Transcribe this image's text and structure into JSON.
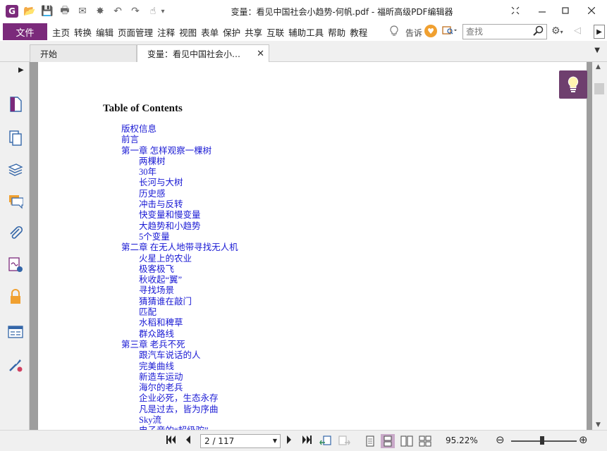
{
  "window": {
    "title": "变量：看见中国社会小趋势-何帆.pdf - 福昕高级PDF编辑器",
    "logo_letter": "G"
  },
  "quick_access": [
    {
      "name": "open-folder-icon",
      "glyph": "📂"
    },
    {
      "name": "save-icon",
      "glyph": "💾"
    },
    {
      "name": "print-icon",
      "glyph": "🖶"
    },
    {
      "name": "email-icon",
      "glyph": "✉"
    },
    {
      "name": "new-icon",
      "glyph": "✸"
    },
    {
      "name": "undo-icon",
      "glyph": "↶"
    },
    {
      "name": "redo-icon",
      "glyph": "↷"
    },
    {
      "name": "hand-tool-icon",
      "glyph": "☝"
    },
    {
      "name": "customize-dropdown-icon",
      "glyph": "▾"
    }
  ],
  "menu": {
    "file": "文件",
    "items": [
      "主页",
      "转换",
      "编辑",
      "页面管理",
      "注释",
      "视图",
      "表单",
      "保护",
      "共享",
      "互联",
      "辅助工具",
      "帮助",
      "教程"
    ],
    "tell_me": "告诉",
    "search_placeholder": "查找"
  },
  "tabs": [
    {
      "label": "开始",
      "active": false
    },
    {
      "label": "变量：看见中国社会小…",
      "active": true
    }
  ],
  "side_icons": [
    "page-thumbnail-icon",
    "pages-icon",
    "layers-icon",
    "comments-icon",
    "attachments-icon",
    "signature-icon",
    "security-icon",
    "form-fields-icon",
    "tools-icon"
  ],
  "document": {
    "toc_title": "Table of Contents",
    "toc": [
      {
        "level": 1,
        "text": "版权信息"
      },
      {
        "level": 1,
        "text": "前言"
      },
      {
        "level": 1,
        "text": "第一章 怎样观察一棵树"
      },
      {
        "level": 2,
        "text": "两棵树"
      },
      {
        "level": 2,
        "text": "30年"
      },
      {
        "level": 2,
        "text": "长河与大树"
      },
      {
        "level": 2,
        "text": "历史感"
      },
      {
        "level": 2,
        "text": "冲击与反转"
      },
      {
        "level": 2,
        "text": "快变量和慢变量"
      },
      {
        "level": 2,
        "text": "大趋势和小趋势"
      },
      {
        "level": 2,
        "text": "5个变量"
      },
      {
        "level": 1,
        "text": "第二章 在无人地带寻找无人机"
      },
      {
        "level": 2,
        "text": "火星上的农业"
      },
      {
        "level": 2,
        "text": "极客极飞"
      },
      {
        "level": 2,
        "text": "秋收起“翼”"
      },
      {
        "level": 2,
        "text": "寻找场景"
      },
      {
        "level": 2,
        "text": "猜猜谁在敲门"
      },
      {
        "level": 2,
        "text": "匹配"
      },
      {
        "level": 2,
        "text": "水稻和稗草"
      },
      {
        "level": 2,
        "text": "群众路线"
      },
      {
        "level": 1,
        "text": "第三章 老兵不死"
      },
      {
        "level": 2,
        "text": "跟汽车说话的人"
      },
      {
        "level": 2,
        "text": "完美曲线"
      },
      {
        "level": 2,
        "text": "新造车运动"
      },
      {
        "level": 2,
        "text": "海尔的老兵"
      },
      {
        "level": 2,
        "text": "企业必死，生态永存"
      },
      {
        "level": 2,
        "text": "凡是过去，皆为序曲"
      },
      {
        "level": 2,
        "text": "Sky流"
      },
      {
        "level": 2,
        "text": "电子音的“超级驼”"
      }
    ]
  },
  "status": {
    "page_indicator": "2 / 117",
    "zoom": "95.22%",
    "zoom_fraction": 0.45
  },
  "colors": {
    "accent": "#7b2a7b",
    "link": "#1a1ad4",
    "tip_button": "#6e3f6e"
  }
}
